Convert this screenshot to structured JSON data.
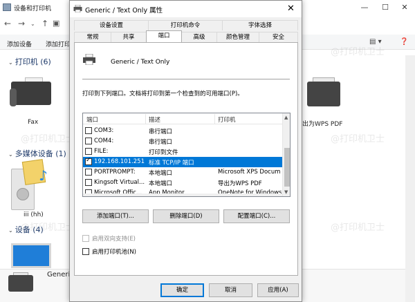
{
  "background": {
    "window_title": "设备和打印机",
    "toolbar": {
      "add_device": "添加设备",
      "add_printer": "添加打印"
    },
    "sections": {
      "printers": "打印机 (6)",
      "multimedia": "多媒体设备 (1)",
      "devices": "设备 (4)"
    },
    "device_labels": {
      "fax": "Fax",
      "wps_pdf": "出为WPS PDF",
      "media_device": "iii (hh)",
      "generic_device": "Generic"
    }
  },
  "dialog": {
    "title": "Generic / Text Only 属性",
    "close_glyph": "✕",
    "tabs_row1": [
      "设备设置",
      "打印机命令",
      "字体选择"
    ],
    "tabs_row2": [
      "常规",
      "共享",
      "端口",
      "高级",
      "颜色管理",
      "安全"
    ],
    "active_tab": "端口",
    "printer_name": "Generic / Text Only",
    "instruction": "打印到下列端口。文档将打印到第一个检查到的可用端口(P)。",
    "port_list": {
      "columns": [
        "端口",
        "描述",
        "打印机"
      ],
      "rows": [
        {
          "checked": false,
          "port": "COM3:",
          "desc": "串行端口",
          "printer": "",
          "selected": false
        },
        {
          "checked": false,
          "port": "COM4:",
          "desc": "串行端口",
          "printer": "",
          "selected": false
        },
        {
          "checked": false,
          "port": "FILE:",
          "desc": "打印到文件",
          "printer": "",
          "selected": false
        },
        {
          "checked": true,
          "port": "192.168.101.251",
          "desc": "标准 TCP/IP 端口",
          "printer": "",
          "selected": true
        },
        {
          "checked": false,
          "port": "PORTPROMPT:",
          "desc": "本地端口",
          "printer": "Microsoft XPS Docum",
          "selected": false
        },
        {
          "checked": false,
          "port": "Kingsoft Virtual...",
          "desc": "本地端口",
          "printer": "导出为WPS PDF",
          "selected": false
        },
        {
          "checked": false,
          "port": "Microsoft Offic...",
          "desc": "App Monitor",
          "printer": "OneNote for Windows",
          "selected": false
        }
      ]
    },
    "buttons": {
      "add_port": "添加端口(T)...",
      "delete_port": "删除端口(D)",
      "configure_port": "配置端口(C)..."
    },
    "options": {
      "bidirectional": "启用双向支持(E)",
      "printer_pool": "启用打印机池(N)"
    },
    "footer": {
      "ok": "确定",
      "cancel": "取消",
      "apply": "应用(A)"
    }
  },
  "watermark": "@打印机卫士",
  "colors": {
    "selection": "#0078d7",
    "dialog_bg": "#f0f0f0"
  }
}
